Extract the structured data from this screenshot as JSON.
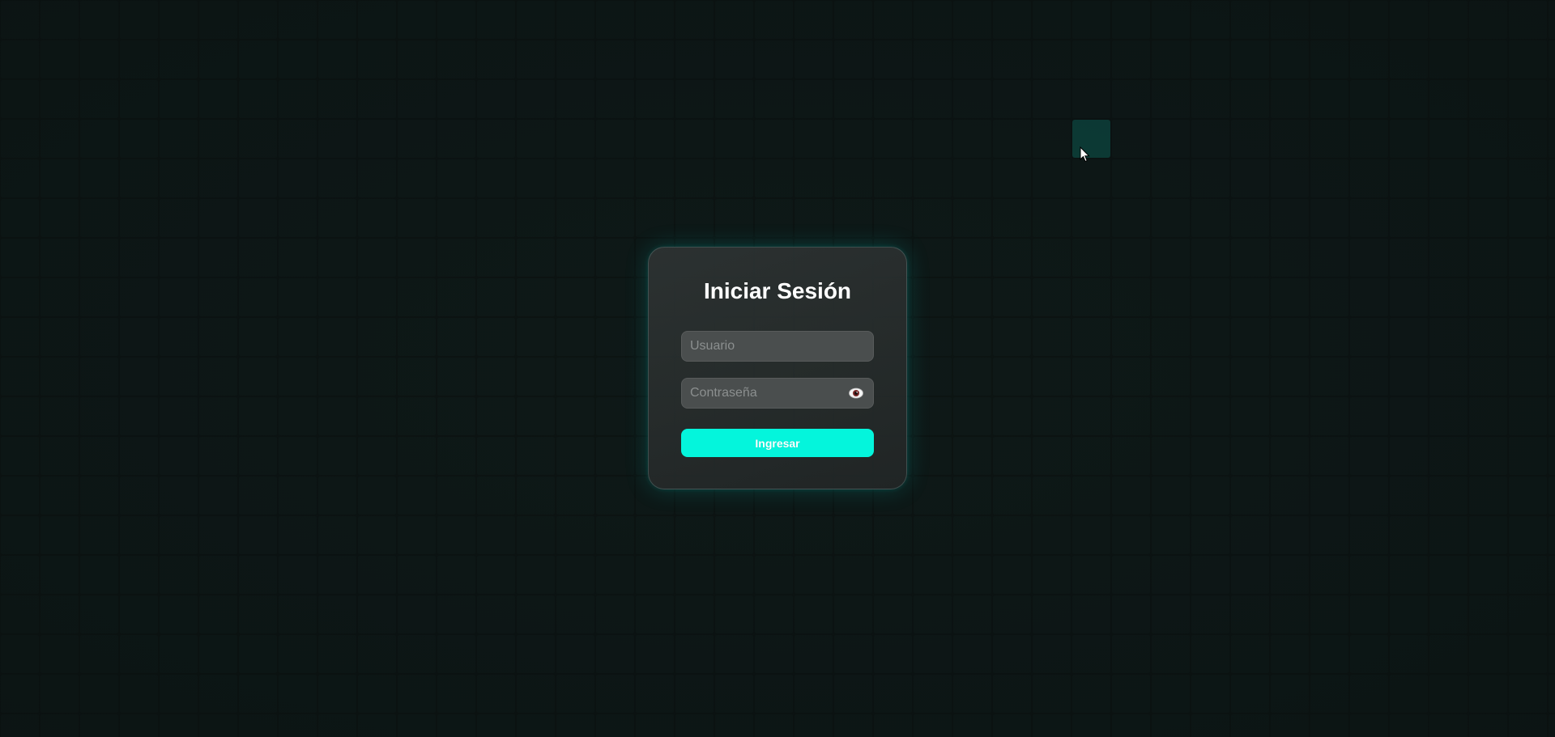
{
  "login": {
    "title": "Iniciar Sesión",
    "username_placeholder": "Usuario",
    "password_placeholder": "Contraseña",
    "submit_label": "Ingresar",
    "toggle_password_icon": "eye-icon"
  },
  "colors": {
    "background": "#0c1413",
    "grid_cell": "#0e1918",
    "highlighted_cell": "#0d433d",
    "card": "#2a3030",
    "input": "#4a4e4e",
    "accent": "#04f5dc"
  }
}
